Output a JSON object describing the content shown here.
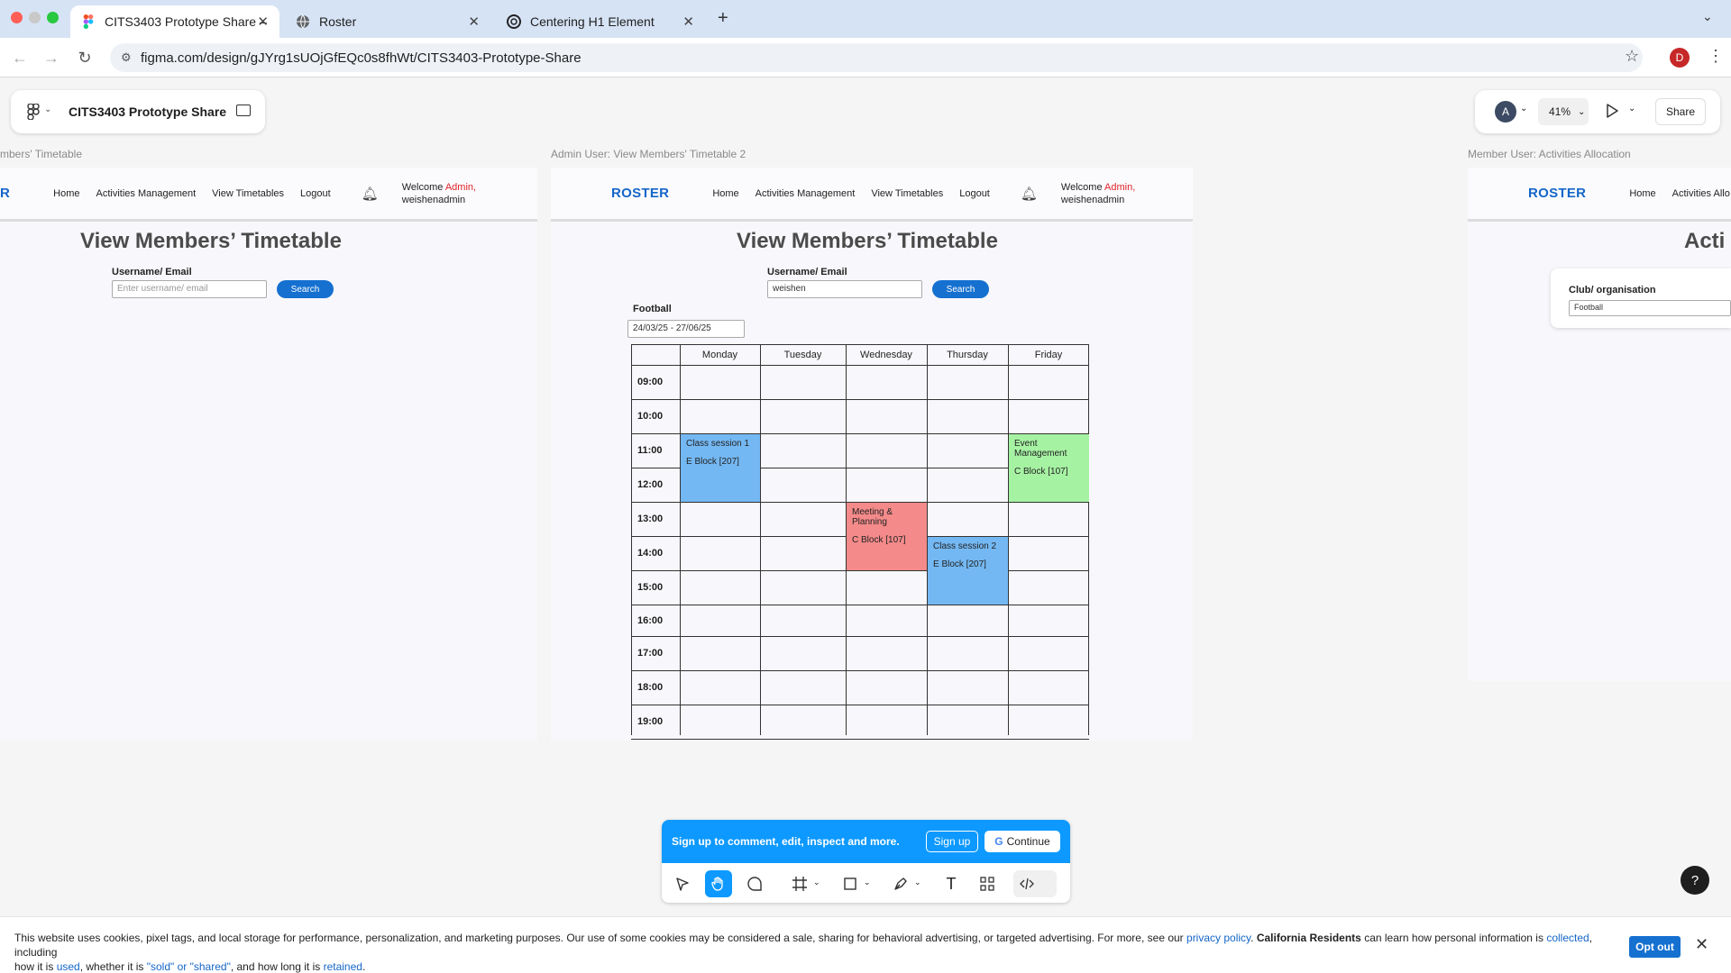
{
  "browser": {
    "tabs": [
      {
        "label": "CITS3403 Prototype Share –",
        "active": true
      },
      {
        "label": "Roster"
      },
      {
        "label": "Centering H1 Element"
      }
    ],
    "url": "figma.com/design/gJYrg1sUOjGfEQc0s8fhWt/CITS3403-Prototype-Share",
    "profile_initial": "D"
  },
  "figma": {
    "file_title": "CITS3403 Prototype Share",
    "user_initial": "A",
    "zoom": "41%",
    "share_label": "Share",
    "frames": {
      "left_label": "mbers' Timetable",
      "center_label": "Admin User: View Members' Timetable 2",
      "right_label": "Member User: Activities Allocation"
    }
  },
  "roster": {
    "logo": "ROSTER",
    "logo_partial": "R",
    "nav": [
      "Home",
      "Activities Management",
      "View Timetables",
      "Logout"
    ],
    "nav_right_partial": [
      "Home",
      "Activities Allo"
    ],
    "welcome_prefix": "Welcome ",
    "welcome_role": "Admin,",
    "welcome_user": "weishenadmin",
    "page_title": "View Members’ Timetable",
    "field_label": "Username/ Email",
    "field_placeholder": "Enter username/ email",
    "field_value": "weishen",
    "search_label": "Search",
    "club_name": "Football",
    "date_range": "24/03/25 - 27/06/25",
    "right_title_partial": "Acti",
    "right_club_label": "Club/ organisation",
    "right_club_value": "Football"
  },
  "timetable": {
    "days": [
      "Monday",
      "Tuesday",
      "Wednesday",
      "Thursday",
      "Friday"
    ],
    "times": [
      "09:00",
      "10:00",
      "11:00",
      "12:00",
      "13:00",
      "14:00",
      "15:00",
      "16:00",
      "17:00",
      "18:00",
      "19:00"
    ],
    "events": [
      {
        "title": "Class session 1",
        "room": "E Block [207]",
        "day": "Monday",
        "start": "11:00",
        "end": "13:00",
        "color": "#74b8f3"
      },
      {
        "title": "Event Management",
        "room": "C Block [107]",
        "day": "Friday",
        "start": "11:00",
        "end": "13:00",
        "color": "#a6f2a3"
      },
      {
        "title": "Meeting & Planning",
        "room": "C Block [107]",
        "day": "Wednesday",
        "start": "13:00",
        "end": "15:00",
        "color": "#f48a8a"
      },
      {
        "title": "Class session 2",
        "room": "E Block [207]",
        "day": "Thursday",
        "start": "14:00",
        "end": "16:00",
        "color": "#74b8f3"
      }
    ]
  },
  "signup": {
    "message": "Sign up to comment, edit, inspect and more.",
    "signup_label": "Sign up",
    "continue_label": "Continue"
  },
  "cookie": {
    "text1": "This website uses cookies, pixel tags, and local storage for performance, personalization, and marketing purposes. Our use of some cookies may be considered a sale, sharing for behavioral advertising, or targeted advertising. For more, see our ",
    "privacy_link": "privacy policy",
    "text2": ". ",
    "bold": "California Residents",
    "text3": " can learn how personal information is ",
    "collected_link": "collected",
    "text4": ", including",
    "text5": "how it is ",
    "used_link": "used",
    "text6": ", whether it is ",
    "sold_link": "\"sold\" or \"shared\"",
    "text7": ", and how long it is ",
    "retained_link": "retained",
    "text8": ".",
    "opt_out_label": "Opt out"
  },
  "colors": {
    "figma_blue": "#0d99ff",
    "roster_blue": "#1566c9",
    "admin_red": "#e0242a"
  }
}
